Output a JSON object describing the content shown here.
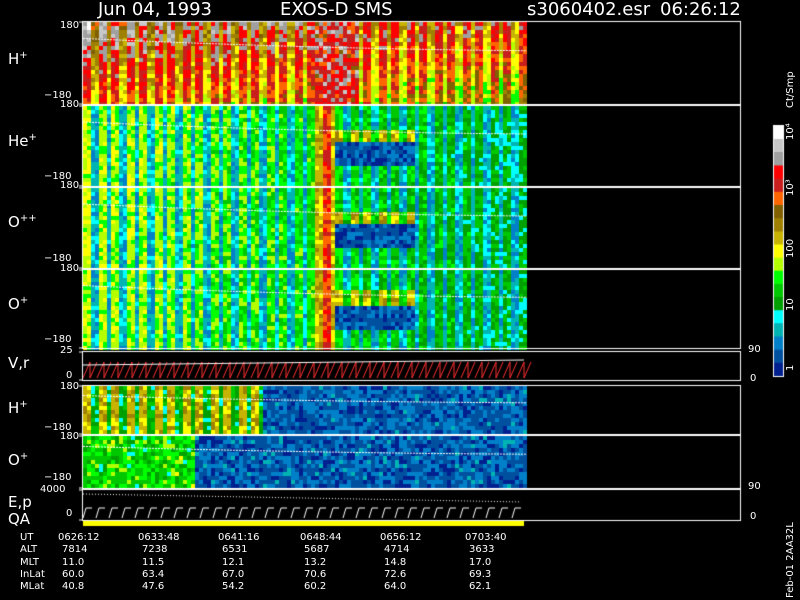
{
  "header": {
    "date": "Jun 04, 1993",
    "instrument": "EXOS-D SMS",
    "filename": "s3060402.esr",
    "time": "06:26:12"
  },
  "colorbar": {
    "unit": "Ct/Smp",
    "tick_labels": [
      "10⁴",
      "10³",
      "100",
      "10",
      "1"
    ],
    "colors": [
      "#ffffff",
      "#c8c8c8",
      "#a0a0a0",
      "#ff0000",
      "#c81e1e",
      "#ff6600",
      "#806000",
      "#a08000",
      "#c8b400",
      "#ffff00",
      "#b4ff00",
      "#00ff00",
      "#00c800",
      "#00a000",
      "#00ffff",
      "#00b4b4",
      "#0080c8",
      "#0050a0",
      "#002090"
    ]
  },
  "panels": [
    {
      "label_base": "H",
      "label_sup": "+",
      "ymax": "180",
      "ymin": "−180"
    },
    {
      "label_base": "He",
      "label_sup": "+",
      "ymax": "180",
      "ymin": "−180"
    },
    {
      "label_base": "O",
      "label_sup": "++",
      "ymax": "180",
      "ymin": "−180"
    },
    {
      "label_base": "O",
      "label_sup": "+",
      "ymax": "180",
      "ymin": "−180"
    },
    {
      "label_base": "V,r",
      "label_sup": "",
      "ymax": "25",
      "ymin": "0",
      "right_top": "90",
      "right_bottom": "0"
    },
    {
      "label_base": "H",
      "label_sup": "+",
      "ymax": "180",
      "ymin": "−180"
    },
    {
      "label_base": "O",
      "label_sup": "+",
      "ymax": "180",
      "ymin": "−180"
    },
    {
      "label_base": "E,p",
      "label2": "QA",
      "label_sup": "",
      "ymax": "4000",
      "ymin": "0",
      "right_top": "90",
      "right_bottom": "0"
    }
  ],
  "time_axis": {
    "row_labels": [
      "UT",
      "ALT",
      "MLT",
      "InLat",
      "MLat"
    ],
    "columns": [
      [
        "0626:12",
        "7814",
        "11.0",
        "60.0",
        "40.8"
      ],
      [
        "0633:48",
        "7238",
        "11.5",
        "63.4",
        "47.6"
      ],
      [
        "0641:16",
        "6531",
        "12.1",
        "67.0",
        "54.2"
      ],
      [
        "0648:44",
        "5687",
        "13.2",
        "70.6",
        "60.2"
      ],
      [
        "0656:12",
        "4714",
        "14.8",
        "72.6",
        "64.0"
      ],
      [
        "0703:40",
        "3633",
        "17.0",
        "69.3",
        "62.1"
      ]
    ]
  },
  "footer_code": "Feb-01 2AA32L",
  "chart_data": {
    "type": "heatmap",
    "title": "Jun 04, 1993 EXOS-D SMS",
    "x": [
      "0626:12",
      "0633:48",
      "0641:16",
      "0648:44",
      "0656:12",
      "0703:40"
    ],
    "xlabel": "UT",
    "series": [
      {
        "name": "H+",
        "ylim": [
          -180,
          180
        ]
      },
      {
        "name": "He+",
        "ylim": [
          -180,
          180
        ]
      },
      {
        "name": "O++",
        "ylim": [
          -180,
          180
        ]
      },
      {
        "name": "O+",
        "ylim": [
          -180,
          180
        ]
      },
      {
        "name": "V,r",
        "ylim": [
          0,
          25
        ]
      },
      {
        "name": "H+",
        "ylim": [
          -180,
          180
        ]
      },
      {
        "name": "O+",
        "ylim": [
          -180,
          180
        ]
      },
      {
        "name": "E,p",
        "ylim": [
          0,
          4000
        ]
      }
    ],
    "colorscale": "log",
    "color_range": [
      1,
      10000
    ],
    "legend": "right"
  }
}
